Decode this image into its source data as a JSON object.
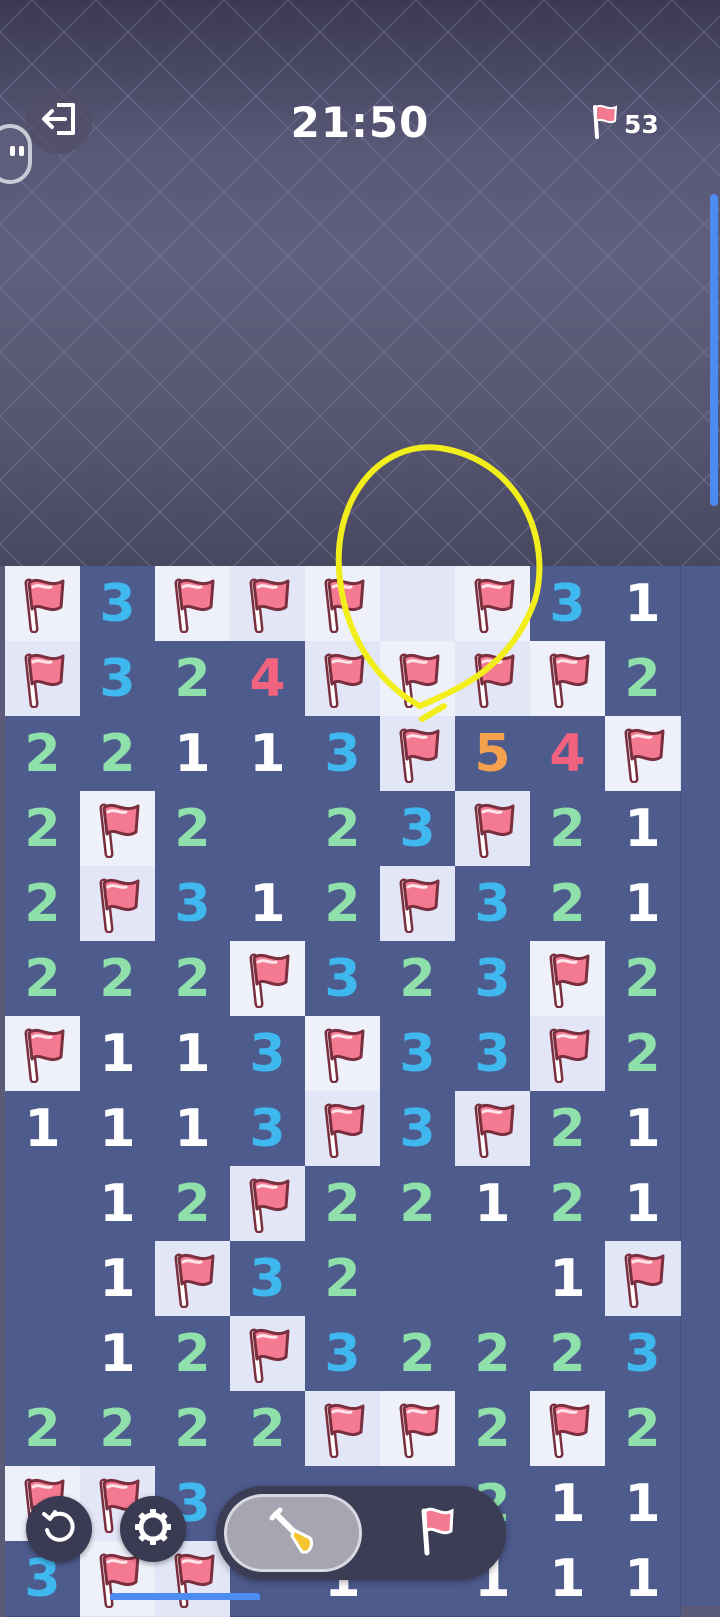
{
  "header": {
    "timer": "21:50",
    "flags_remaining": "53"
  },
  "icons": {
    "exit": "exit-icon",
    "flag": "flag-icon",
    "restart": "restart-icon",
    "settings": "gear-icon",
    "dig": "shovel-icon"
  },
  "colors": {
    "background": "#5b5a79",
    "open_cell": "#4e5b8d",
    "hidden_cell": "#eef0fa",
    "num_1": "#ffffff",
    "num_2": "#8fe0ab",
    "num_3": "#3fb7ef",
    "num_4": "#f0627d",
    "num_5": "#f5a14e",
    "flag": "#f47a91",
    "annotation": "#f1ee1b",
    "accent": "#4c8cf1"
  },
  "board": {
    "legend": "F = flagged cell, H = unopened cell, . = empty opened cell, digit = adjacent mine count",
    "rows": [
      [
        "F",
        "3",
        "F",
        "F",
        "F",
        "H",
        "F",
        "3",
        "1"
      ],
      [
        "F",
        "3",
        "2",
        "4",
        "F",
        "F",
        "F",
        "F",
        "2"
      ],
      [
        "2",
        "2",
        "1",
        "1",
        "3",
        "F",
        "5",
        "4",
        "F"
      ],
      [
        "2",
        "F",
        "2",
        ".",
        "2",
        "3",
        "F",
        "2",
        "1"
      ],
      [
        "2",
        "F",
        "3",
        "1",
        "2",
        "F",
        "3",
        "2",
        "1"
      ],
      [
        "2",
        "2",
        "2",
        "F",
        "3",
        "2",
        "3",
        "F",
        "2"
      ],
      [
        "F",
        "1",
        "1",
        "3",
        "F",
        "3",
        "3",
        "F",
        "2"
      ],
      [
        "1",
        "1",
        "1",
        "3",
        "F",
        "3",
        "F",
        "2",
        "1"
      ],
      [
        ".",
        "1",
        "2",
        "F",
        "2",
        "2",
        "1",
        "2",
        "1"
      ],
      [
        ".",
        "1",
        "F",
        "3",
        "2",
        ".",
        ".",
        "1",
        "F"
      ],
      [
        ".",
        "1",
        "2",
        "F",
        "3",
        "2",
        "2",
        "2",
        "3"
      ],
      [
        "2",
        "2",
        "2",
        "2",
        "F",
        "F",
        "2",
        "F",
        "2"
      ],
      [
        "F",
        "F",
        "3",
        ".",
        ".",
        ".",
        "2",
        "1",
        "1"
      ],
      [
        "3",
        "F",
        "F",
        ".",
        "1",
        ".",
        "1",
        "1",
        "1"
      ]
    ]
  },
  "toolbar": {
    "mode_selected": "dig"
  }
}
